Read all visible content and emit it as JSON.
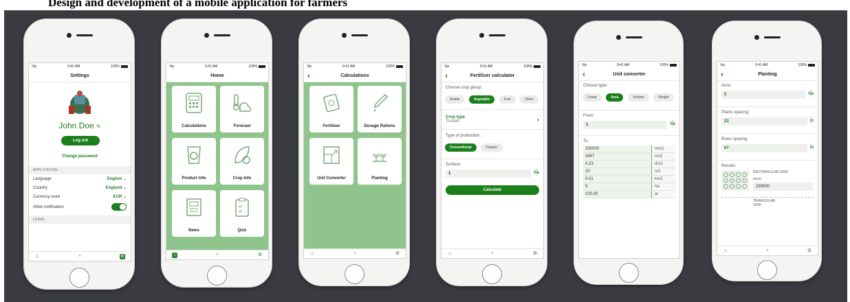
{
  "title": "Design and development of a mobile application for farmers",
  "status": {
    "carrier": "Vip",
    "time": "9:41 AM",
    "battery": "100%"
  },
  "settings": {
    "nav_title": "Settings",
    "user_name": "John Doe",
    "logout": "Log out",
    "change_password": "Change password",
    "section_application": "APPLICATION",
    "rows": [
      {
        "label": "Language",
        "value": "English"
      },
      {
        "label": "Country",
        "value": "England"
      },
      {
        "label": "Currency used",
        "value": "EUR"
      }
    ],
    "notification_label": "Allow notification",
    "section_legal": "LEGAL"
  },
  "home": {
    "nav_title": "Home",
    "tiles": [
      "Calculations",
      "Forecast",
      "Product Info",
      "Crop Info",
      "News",
      "Quiz"
    ]
  },
  "calculations": {
    "nav_title": "Calculations",
    "tiles": [
      "Fertiliser",
      "Dosage Rations",
      "Unit Converter",
      "Planting"
    ]
  },
  "fertiliser": {
    "nav_title": "Fertiliser calculator",
    "crop_group_label": "Choose crop group:",
    "crop_groups": [
      "Arable",
      "Vegetable",
      "Fruit",
      "Other"
    ],
    "crop_type_label": "Crop type",
    "crop_type_value": "Tomato",
    "production_label": "Type of production:",
    "productions": [
      "Conventional",
      "Organic"
    ],
    "surface_label": "Surface:",
    "surface_value": "1",
    "surface_unit": "Ha",
    "calculate": "Calculate"
  },
  "converter": {
    "nav_title": "Unit converter",
    "type_label": "Choose type:",
    "types": [
      "Linear",
      "Area",
      "Volume",
      "Weight"
    ],
    "from_label": "From:",
    "from_value": "1",
    "from_unit": "Ha",
    "to_label": "To:",
    "results": [
      {
        "value": "230000",
        "unit": "mm2"
      },
      {
        "value": "3467",
        "unit": "cm2"
      },
      {
        "value": "0.23",
        "unit": "dm2"
      },
      {
        "value": "10",
        "unit": "m2"
      },
      {
        "value": "0.01",
        "unit": "km2"
      },
      {
        "value": "5",
        "unit": "ha"
      },
      {
        "value": "100.00",
        "unit": "ar"
      }
    ]
  },
  "planting": {
    "nav_title": "Planting",
    "area_label": "Area:",
    "area_value": "5",
    "area_unit": "Ha",
    "plants_label": "Plants spacing:",
    "plants_value": "23",
    "plants_unit": "m",
    "rows_label": "Rows spacing:",
    "rows_value": "67",
    "rows_unit": "m",
    "results_label": "Results:",
    "rect_label": "RECTANGULAR GRID",
    "pieces_label": "pices:",
    "pieces_value": "230000",
    "tri_label": "TRIANGULAR GRID"
  },
  "colors": {
    "primary": "#1b7f1b",
    "tile_bg": "#8fc48c",
    "stage": "#3a3b40"
  }
}
